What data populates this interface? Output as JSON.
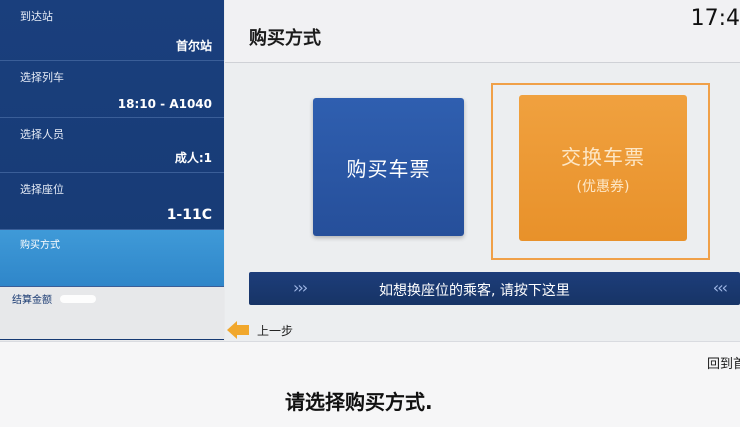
{
  "sidebar": {
    "arrival": {
      "label": "到达站",
      "value": "首尔站"
    },
    "train": {
      "label": "选择列车",
      "value": "18:10 - A1040"
    },
    "passengers": {
      "label": "选择人员",
      "value": "成人:1"
    },
    "seat": {
      "label": "选择座位",
      "value": "1-11C"
    },
    "method": {
      "label": "购买方式"
    },
    "total": {
      "label": "结算金额"
    }
  },
  "header": {
    "title": "购买方式",
    "clock": "17:4"
  },
  "options": {
    "buy": "购买车票",
    "exchange": "交换车票",
    "exchange_sub": "(优惠券)"
  },
  "banner": {
    "text": "如想换座位的乘客, 请按下这里",
    "arrows_left": "›››",
    "arrows_right": "‹‹‹"
  },
  "nav": {
    "back": "上一步",
    "home": "回到首"
  },
  "instruction": "请选择购买方式."
}
